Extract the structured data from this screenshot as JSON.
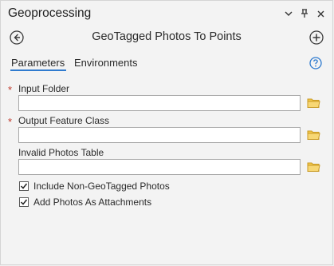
{
  "pane": {
    "title": "Geoprocessing",
    "title_icons": [
      "chevron-down-icon",
      "pin-icon",
      "close-icon"
    ]
  },
  "tool": {
    "name": "GeoTagged Photos To Points",
    "back_icon": "back-arrow-icon",
    "add_icon": "add-icon"
  },
  "tabs": [
    {
      "label": "Parameters",
      "active": true
    },
    {
      "label": "Environments",
      "active": false
    }
  ],
  "help_icon": "help-icon",
  "parameters": [
    {
      "label": "Input Folder",
      "required": true,
      "value": "",
      "browse_icon": "folder-icon"
    },
    {
      "label": "Output Feature Class",
      "required": true,
      "value": "",
      "browse_icon": "folder-icon"
    },
    {
      "label": "Invalid Photos Table",
      "required": false,
      "value": "",
      "browse_icon": "folder-icon"
    }
  ],
  "required_marker": "*",
  "checkboxes": [
    {
      "label": "Include Non-GeoTagged Photos",
      "checked": true
    },
    {
      "label": "Add Photos As Attachments",
      "checked": true
    }
  ],
  "colors": {
    "accent": "#2f7bcf",
    "required": "#c0392b",
    "folder": "#e2b43b"
  }
}
